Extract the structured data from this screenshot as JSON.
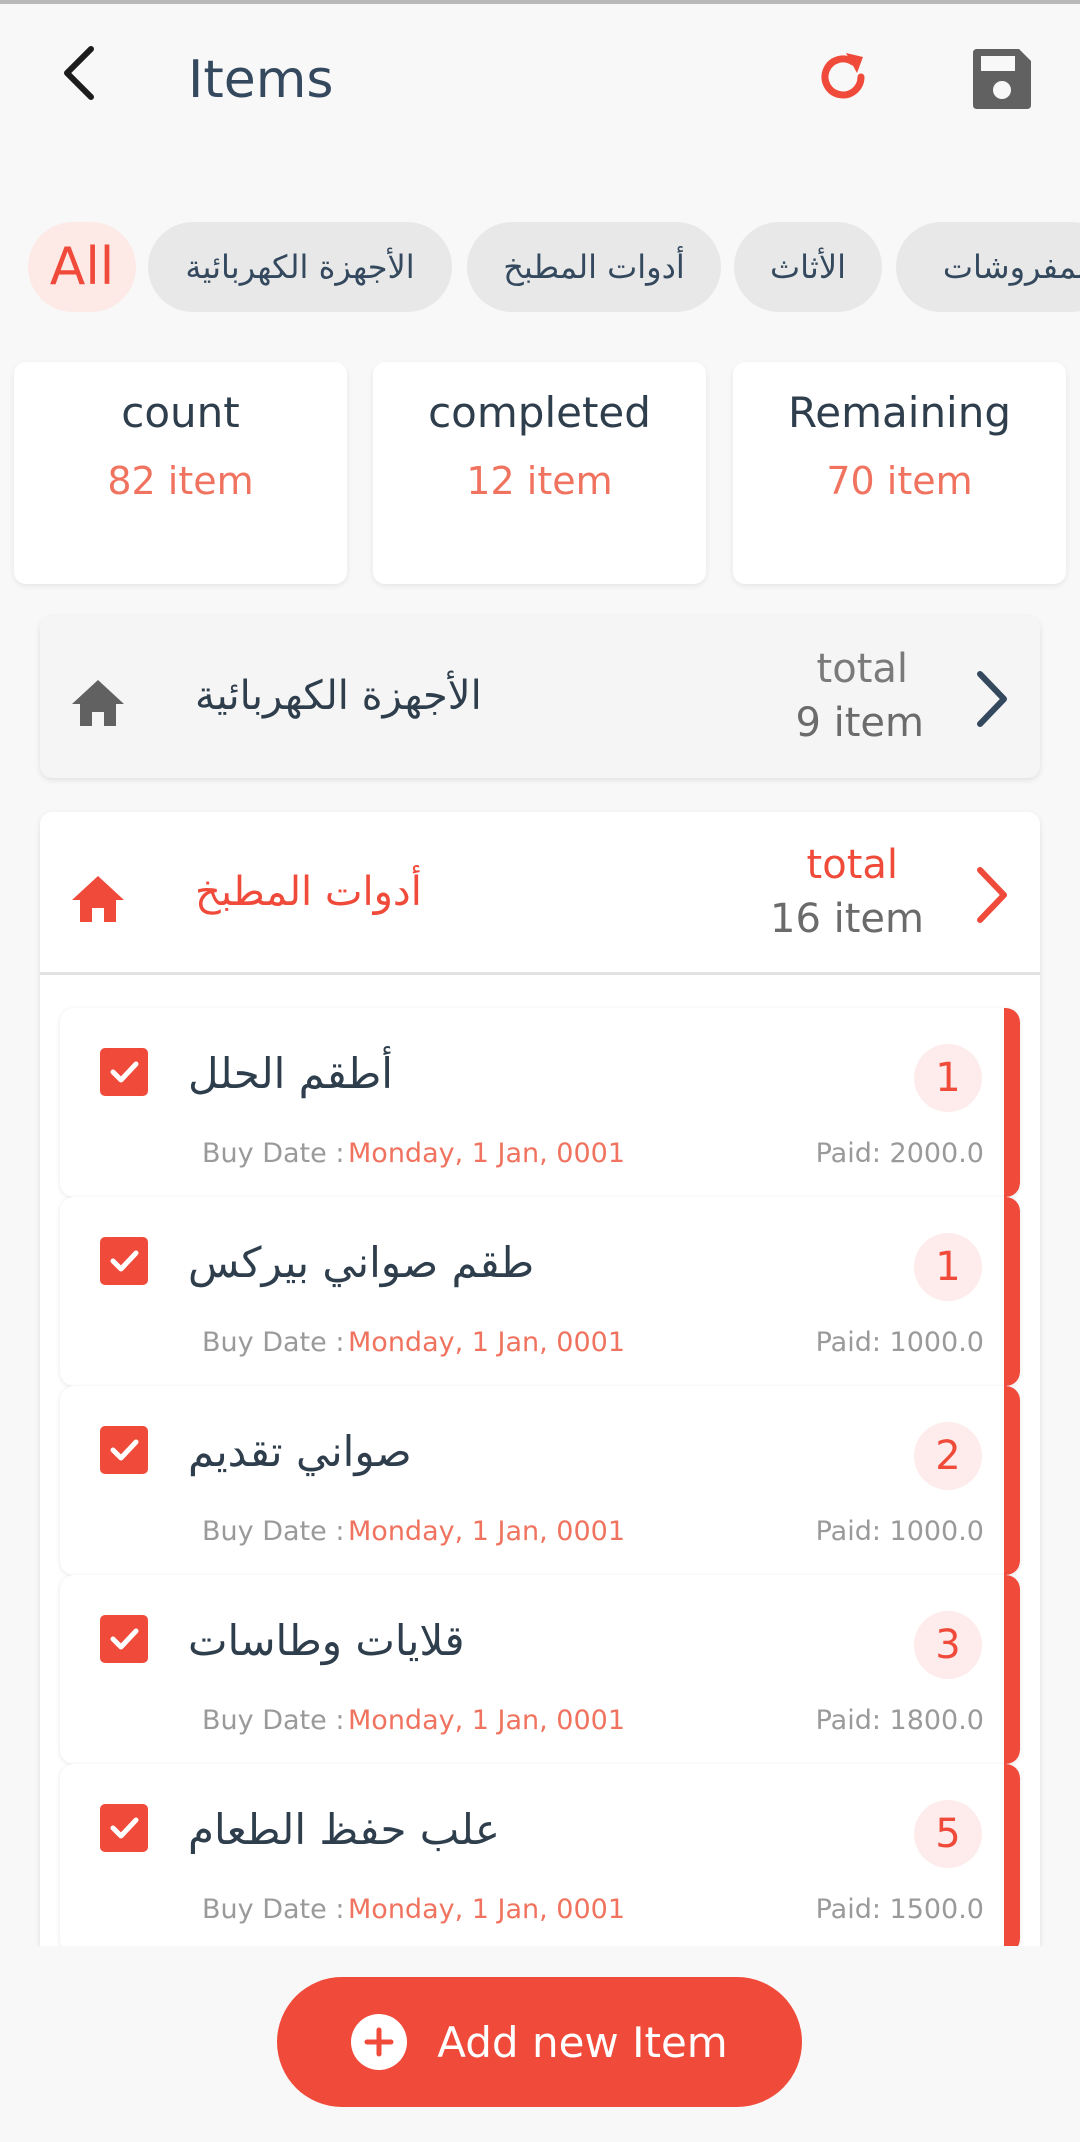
{
  "appbar": {
    "title": "Items"
  },
  "chips": [
    {
      "label": "All"
    },
    {
      "label": "الأجهزة الكهربائية"
    },
    {
      "label": "أدوات المطبخ"
    },
    {
      "label": "الأثاث"
    },
    {
      "label": "المفروشات"
    }
  ],
  "stats": [
    {
      "label": "count",
      "value": "82 item"
    },
    {
      "label": "completed",
      "value": "12 item"
    },
    {
      "label": "Remaining",
      "value": "70 item"
    }
  ],
  "categories": [
    {
      "name": "الأجهزة الكهربائية",
      "total_label": "total",
      "total_value": "9 item"
    },
    {
      "name": "أدوات المطبخ",
      "total_label": "total",
      "total_value": "16 item"
    }
  ],
  "items": [
    {
      "name": "أطقم الحلل",
      "qty": "1",
      "buy_label": "Buy Date :",
      "buy_date": "Monday, 1 Jan, 0001",
      "paid": "Paid: 2000.0"
    },
    {
      "name": "طقم صواني بيركس",
      "qty": "1",
      "buy_label": "Buy Date :",
      "buy_date": "Monday, 1 Jan, 0001",
      "paid": "Paid: 1000.0"
    },
    {
      "name": "صواني تقديم",
      "qty": "2",
      "buy_label": "Buy Date :",
      "buy_date": "Monday, 1 Jan, 0001",
      "paid": "Paid: 1000.0"
    },
    {
      "name": "قلايات وطاسات",
      "qty": "3",
      "buy_label": "Buy Date :",
      "buy_date": "Monday, 1 Jan, 0001",
      "paid": "Paid: 1800.0"
    },
    {
      "name": "علب حفظ الطعام",
      "qty": "5",
      "buy_label": "Buy Date :",
      "buy_date": "Monday, 1 Jan, 0001",
      "paid": "Paid: 1500.0"
    }
  ],
  "add_button": {
    "label": "Add new Item"
  },
  "icons": {
    "back": "back-arrow-icon",
    "refresh": "refresh-icon",
    "save": "save-icon",
    "home": "home-icon",
    "chevron": "chevron-right-icon",
    "check": "checkbox-checked-icon",
    "add": "plus-circle-icon"
  },
  "colors": {
    "accent": "#f04a3a",
    "accent_light": "#fde9e6",
    "text": "#2f3e4c"
  }
}
